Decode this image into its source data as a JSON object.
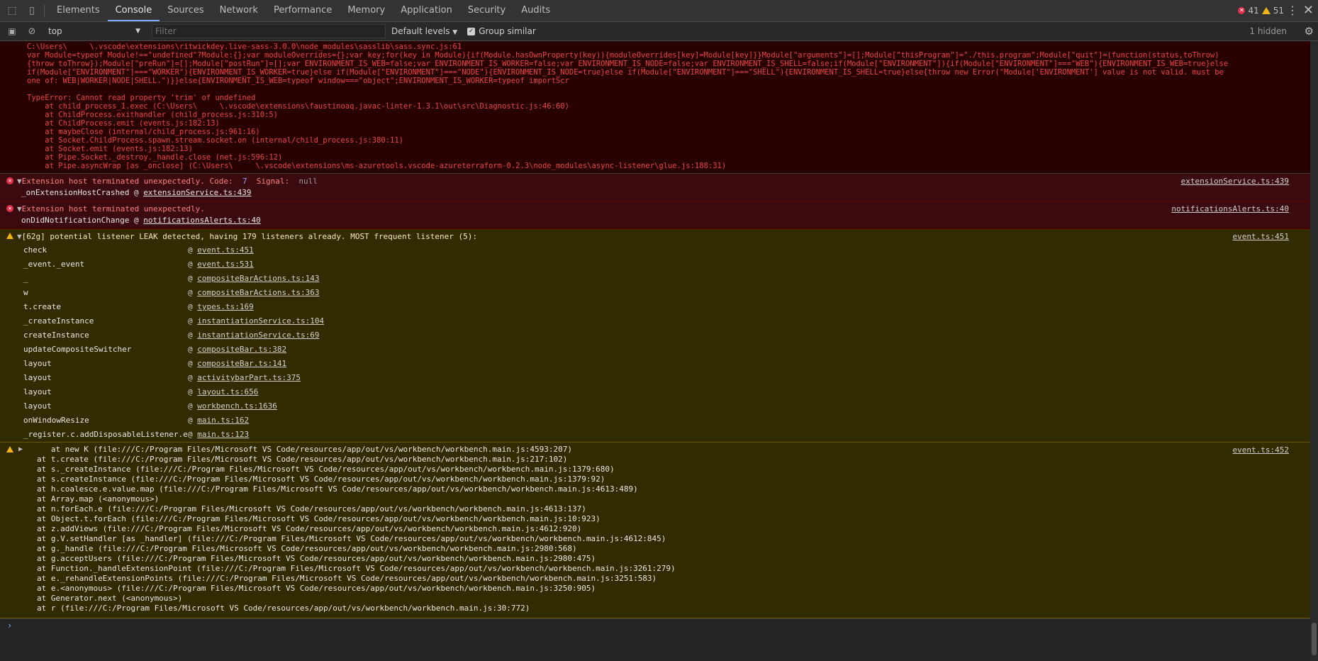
{
  "toolbar": {
    "tabs": [
      "Elements",
      "Console",
      "Sources",
      "Network",
      "Performance",
      "Memory",
      "Application",
      "Security",
      "Audits"
    ],
    "active_tab": "Console",
    "error_count": "41",
    "warning_count": "51"
  },
  "filterbar": {
    "context": "top",
    "filter_placeholder": "Filter",
    "levels": "Default levels",
    "group_similar": "Group similar",
    "group_similar_checked": true,
    "hidden": "1 hidden"
  },
  "stack_error": {
    "lines": [
      "C:\\Users\\     \\.vscode\\extensions\\ritwickdey.live-sass-3.0.0\\node_modules\\sasslib\\sass.sync.js:61",
      "var Module=typeof Module!==\"undefined\"?Module:{};var moduleOverrides={};var key;for(key in Module){if(Module.hasOwnProperty(key)){moduleOverrides[key]=Module[key]}}Module[\"arguments\"]=[];Module[\"thisProgram\"]=\"./this.program\";Module[\"quit\"]=(function(status,toThrow)",
      "{throw toThrow});Module[\"preRun\"]=[];Module[\"postRun\"]=[];var ENVIRONMENT_IS_WEB=false;var ENVIRONMENT_IS_WORKER=false;var ENVIRONMENT_IS_NODE=false;var ENVIRONMENT_IS_SHELL=false;if(Module[\"ENVIRONMENT\"]){if(Module[\"ENVIRONMENT\"]===\"WEB\"){ENVIRONMENT_IS_WEB=true}else",
      "if(Module[\"ENVIRONMENT\"]===\"WORKER\"){ENVIRONMENT_IS_WORKER=true}else if(Module[\"ENVIRONMENT\"]===\"NODE\"){ENVIRONMENT_IS_NODE=true}else if(Module[\"ENVIRONMENT\"]===\"SHELL\"){ENVIRONMENT_IS_SHELL=true}else{throw new Error(\"Module['ENVIRONMENT'] value is not valid. must be",
      "one of: WEB|WORKER|NODE|SHELL.\")}}else{ENVIRONMENT_IS_WEB=typeof window===\"object\";ENVIRONMENT_IS_WORKER=typeof importScr",
      "",
      "TypeError: Cannot read property 'trim' of undefined",
      "    at child_process_1.exec (C:\\Users\\     \\.vscode\\extensions\\faustinoaq.javac-linter-1.3.1\\out\\src\\Diagnostic.js:46:60)",
      "    at ChildProcess.exithandler (child_process.js:310:5)",
      "    at ChildProcess.emit (events.js:182:13)",
      "    at maybeClose (internal/child_process.js:961:16)",
      "    at Socket.ChildProcess.spawn.stream.socket.on (internal/child_process.js:380:11)",
      "    at Socket.emit (events.js:182:13)",
      "    at Pipe.Socket._destroy._handle.close (net.js:596:12)",
      "    at Pipe.asyncWrap [as _onclose] (C:\\Users\\     \\.vscode\\extensions\\ms-azuretools.vscode-azureterraform-0.2.3\\node_modules\\async-listener\\glue.js:188:31)"
    ]
  },
  "messages": [
    {
      "text": "Extension host terminated unexpectedly. Code:  ",
      "code": "7",
      "signal_label": "  Signal:  ",
      "signal": "null",
      "sub_fn": "_onExtensionHostCrashed",
      "sub_loc": "extensionService.ts:439",
      "source": "extensionService.ts:439"
    },
    {
      "text": "Extension host terminated unexpectedly.",
      "sub_fn": "onDidNotificationChange",
      "sub_loc": "notificationsAlerts.ts:40",
      "source": "notificationsAlerts.ts:40"
    }
  ],
  "leak_warning": {
    "text": "[62g] potential listener LEAK detected, having 179 listeners already. MOST frequent listener (5):",
    "source": "event.ts:451",
    "rows": [
      {
        "fn": "check",
        "loc": "event.ts:451"
      },
      {
        "fn": "_event._event",
        "loc": "event.ts:531"
      },
      {
        "fn": "_",
        "loc": "compositeBarActions.ts:143"
      },
      {
        "fn": "w",
        "loc": "compositeBarActions.ts:363"
      },
      {
        "fn": "t.create",
        "loc": "types.ts:169"
      },
      {
        "fn": "_createInstance",
        "loc": "instantiationService.ts:104"
      },
      {
        "fn": "createInstance",
        "loc": "instantiationService.ts:69"
      },
      {
        "fn": "updateCompositeSwitcher",
        "loc": "compositeBar.ts:382"
      },
      {
        "fn": "layout",
        "loc": "compositeBar.ts:141"
      },
      {
        "fn": "layout",
        "loc": "activitybarPart.ts:375"
      },
      {
        "fn": "layout",
        "loc": "layout.ts:656"
      },
      {
        "fn": "layout",
        "loc": "workbench.ts:1636"
      },
      {
        "fn": "onWindowResize",
        "loc": "main.ts:162"
      },
      {
        "fn": "_register.c.addDisposableListener.e",
        "loc": "main.ts:123"
      }
    ]
  },
  "trace_warning": {
    "source": "event.ts:452",
    "lines": [
      "   at new K (file:///C:/Program Files/Microsoft VS Code/resources/app/out/vs/workbench/workbench.main.js:4593:207)",
      "at t.create (file:///C:/Program Files/Microsoft VS Code/resources/app/out/vs/workbench/workbench.main.js:217:102)",
      "at s._createInstance (file:///C:/Program Files/Microsoft VS Code/resources/app/out/vs/workbench/workbench.main.js:1379:680)",
      "at s.createInstance (file:///C:/Program Files/Microsoft VS Code/resources/app/out/vs/workbench/workbench.main.js:1379:92)",
      "at h.coalesce.e.value.map (file:///C:/Program Files/Microsoft VS Code/resources/app/out/vs/workbench/workbench.main.js:4613:489)",
      "at Array.map (<anonymous>)",
      "at n.forEach.e (file:///C:/Program Files/Microsoft VS Code/resources/app/out/vs/workbench/workbench.main.js:4613:137)",
      "at Object.t.forEach (file:///C:/Program Files/Microsoft VS Code/resources/app/out/vs/workbench/workbench.main.js:10:923)",
      "at z.addViews (file:///C:/Program Files/Microsoft VS Code/resources/app/out/vs/workbench/workbench.main.js:4612:920)",
      "at g.V.setHandler [as _handler] (file:///C:/Program Files/Microsoft VS Code/resources/app/out/vs/workbench/workbench.main.js:4612:845)",
      "at g._handle (file:///C:/Program Files/Microsoft VS Code/resources/app/out/vs/workbench/workbench.main.js:2980:568)",
      "at g.acceptUsers (file:///C:/Program Files/Microsoft VS Code/resources/app/out/vs/workbench/workbench.main.js:2980:475)",
      "at Function._handleExtensionPoint (file:///C:/Program Files/Microsoft VS Code/resources/app/out/vs/workbench/workbench.main.js:3261:279)",
      "at e._rehandleExtensionPoints (file:///C:/Program Files/Microsoft VS Code/resources/app/out/vs/workbench/workbench.main.js:3251:583)",
      "at e.<anonymous> (file:///C:/Program Files/Microsoft VS Code/resources/app/out/vs/workbench/workbench.main.js:3250:905)",
      "at Generator.next (<anonymous>)",
      "at r (file:///C:/Program Files/Microsoft VS Code/resources/app/out/vs/workbench/workbench.main.js:30:772)"
    ]
  },
  "prompt_symbol": "›"
}
